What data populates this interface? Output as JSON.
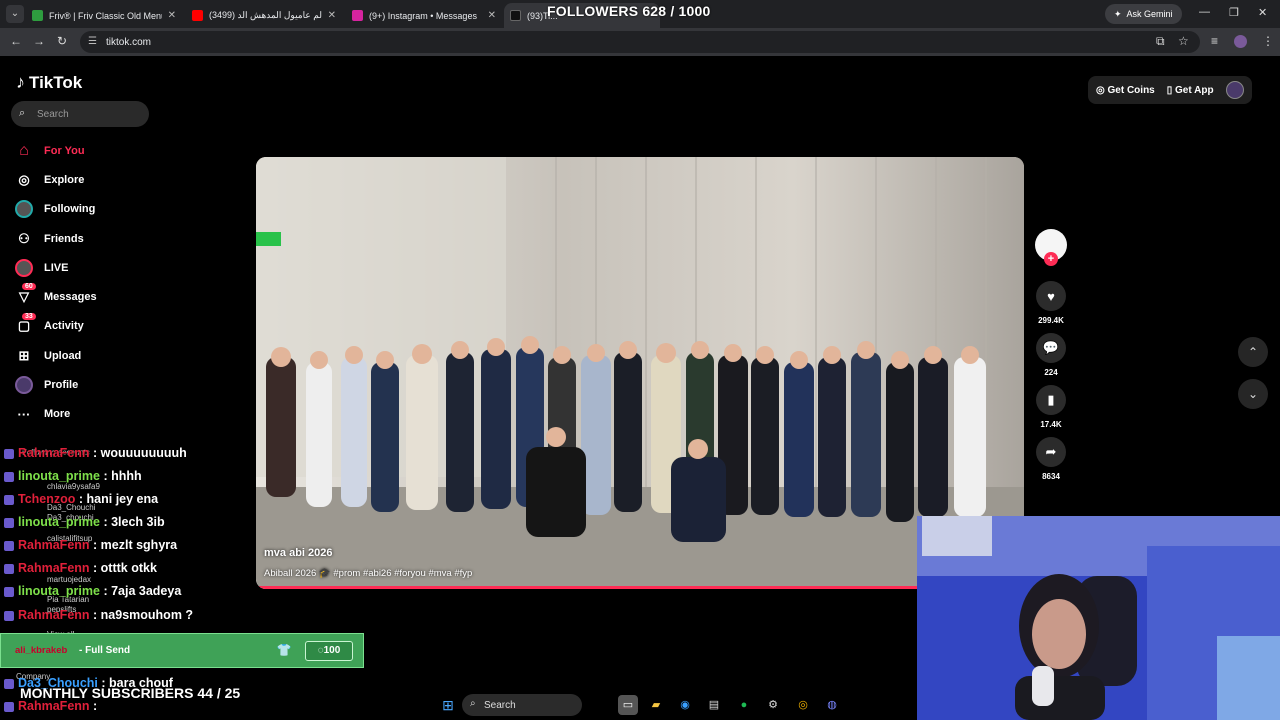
{
  "browser": {
    "tabs": [
      {
        "label": "Friv® | Friv Classic Old Menu",
        "icon": "friv-icon",
        "color": "#2e9d3f"
      },
      {
        "label": "عالم عاميول المدهش الد (3499)",
        "icon": "youtube-icon",
        "color": "#ff0000"
      },
      {
        "label": "(9+) Instagram • Messages",
        "icon": "instagram-icon",
        "color": "#d6249f"
      },
      {
        "label": "(93)Ti...",
        "icon": "tiktok-icon",
        "color": "#111111"
      }
    ],
    "ask_gemini": "Ask Gemini",
    "url": "tiktok.com"
  },
  "overlay": {
    "followers": "FOLLOWERS 628 / 1000",
    "monthly": "MONTHLY SUBSCRIBERS 44 / 25",
    "chat": [
      {
        "user": "RahmaFenn",
        "message": ": wouuuuuuuuh",
        "user_color": "#e0203a"
      },
      {
        "user": "linouta_prime",
        "message": ": hhhh",
        "user_color": "#7ee04a"
      },
      {
        "user": "Tchenzoo",
        "message": ": hani jey ena",
        "user_color": "#e0203a"
      },
      {
        "user": "linouta_prime",
        "message": ": 3lech 3ib",
        "user_color": "#7ee04a"
      },
      {
        "user": "RahmaFenn",
        "message": ": mezlt sghyra",
        "user_color": "#e0203a"
      },
      {
        "user": "RahmaFenn",
        "message": ": otttk otkk",
        "user_color": "#e0203a"
      },
      {
        "user": "linouta_prime",
        "message": ": 7aja 3adeya",
        "user_color": "#7ee04a"
      },
      {
        "user": "RahmaFenn",
        "message": ": na9smouhom ?",
        "user_color": "#e0203a"
      },
      {
        "user": "Da3_Chouchi",
        "message": ": bara chouf",
        "user_color": "#3aa0ff"
      },
      {
        "user": "RahmaFenn",
        "message": ":",
        "user_color": "#e0203a"
      }
    ],
    "ghost_labels": [
      "Following accounts",
      "chlavia9ysafa9",
      "Da3_Chouchi",
      "Da3_chouchi",
      "calistalifitsup",
      "martuojedax",
      "Pia Tatarian",
      "pepslifts",
      "View all",
      "Company"
    ],
    "alert": {
      "user": "ali_kbrakeb",
      "text": "- Full Send",
      "cost": "100"
    }
  },
  "tiktok": {
    "logo": "TikTok",
    "search_placeholder": "Search",
    "nav": [
      {
        "label": "For You",
        "icon": "home-icon",
        "glyph": "⌂",
        "active": true
      },
      {
        "label": "Explore",
        "icon": "compass-icon",
        "glyph": "◎",
        "active": false
      },
      {
        "label": "Following",
        "icon": "following-avatar-icon",
        "glyph": "",
        "active": false
      },
      {
        "label": "Friends",
        "icon": "friends-icon",
        "glyph": "⚇",
        "active": false
      },
      {
        "label": "LIVE",
        "icon": "live-icon",
        "glyph": "",
        "active": false
      },
      {
        "label": "Messages",
        "icon": "messages-icon",
        "glyph": "▽",
        "active": false,
        "badge": "60"
      },
      {
        "label": "Activity",
        "icon": "activity-icon",
        "glyph": "▢",
        "active": false,
        "badge": "33"
      },
      {
        "label": "Upload",
        "icon": "upload-icon",
        "glyph": "⊞",
        "active": false
      },
      {
        "label": "Profile",
        "icon": "profile-icon",
        "glyph": "",
        "active": false
      },
      {
        "label": "More",
        "icon": "more-icon",
        "glyph": "···",
        "active": false
      }
    ],
    "get_coins": "Get Coins",
    "get_app": "Get App",
    "video": {
      "title": "mva abi 2026",
      "tags": "Abiball 2026 🎓 #prom #abi26 #foryou #mva #fyp",
      "progress": 1.0
    },
    "actions": {
      "likes": "299.4K",
      "comments": "224",
      "saves": "17.4K",
      "shares": "8634"
    }
  },
  "taskbar": {
    "search_label": "Search"
  }
}
